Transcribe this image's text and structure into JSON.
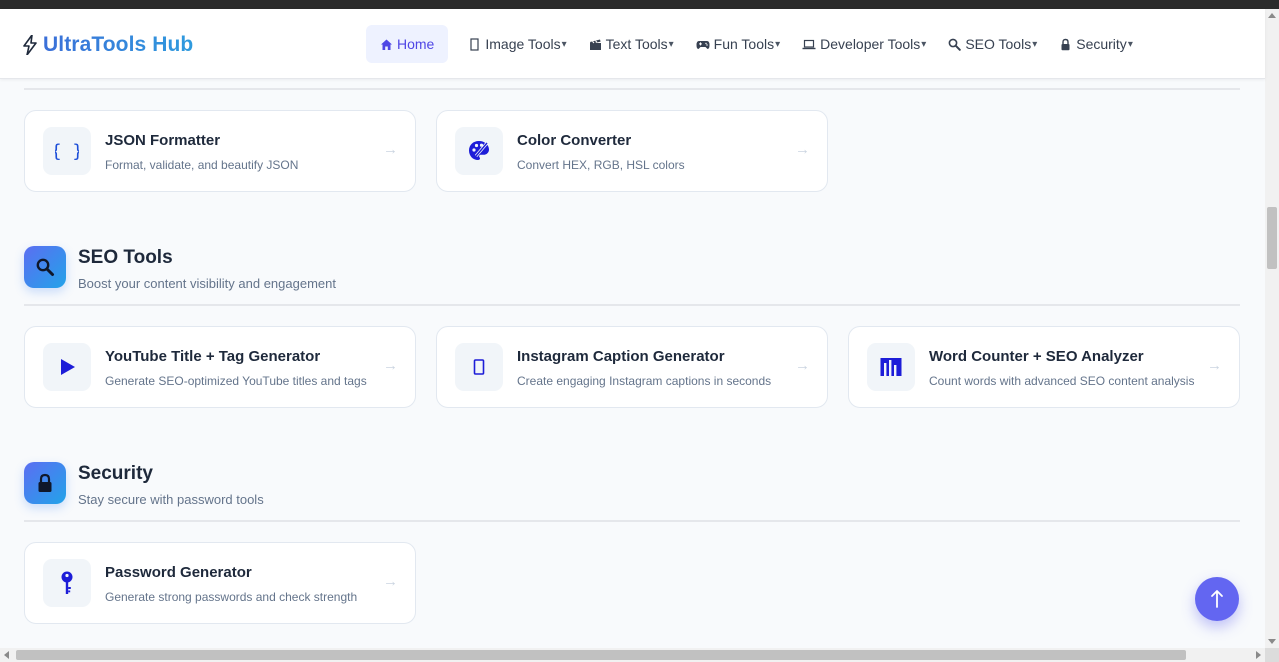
{
  "brand": {
    "name": "UltraTools Hub",
    "icon": "lightning-icon"
  },
  "nav": {
    "home": "Home",
    "image_tools": "Image Tools",
    "text_tools": "Text Tools",
    "fun_tools": "Fun Tools",
    "developer_tools": "Developer Tools",
    "seo_tools": "SEO Tools",
    "security": "Security",
    "caret": "▾"
  },
  "sections": {
    "developer": {
      "cards": [
        {
          "title": "JSON Formatter",
          "desc": "Format, validate, and beautify JSON",
          "icon": "braces-icon"
        },
        {
          "title": "Color Converter",
          "desc": "Convert HEX, RGB, HSL colors",
          "icon": "palette-icon"
        }
      ]
    },
    "seo": {
      "title": "SEO Tools",
      "subtitle": "Boost your content visibility and engagement",
      "icon": "magnifier-icon",
      "cards": [
        {
          "title": "YouTube Title + Tag Generator",
          "desc": "Generate SEO-optimized YouTube titles and tags",
          "icon": "play-icon"
        },
        {
          "title": "Instagram Caption Generator",
          "desc": "Create engaging Instagram captions in seconds",
          "icon": "phone-icon"
        },
        {
          "title": "Word Counter + SEO Analyzer",
          "desc": "Count words with advanced SEO content analysis",
          "icon": "bar-chart-icon"
        }
      ]
    },
    "security": {
      "title": "Security",
      "subtitle": "Stay secure with password tools",
      "icon": "lock-icon",
      "cards": [
        {
          "title": "Password Generator",
          "desc": "Generate strong passwords and check strength",
          "icon": "key-icon"
        }
      ]
    }
  },
  "card_arrow": "→",
  "back_to_top": "↑",
  "colors": {
    "accent": "#6366f1",
    "brand_gradient_start": "#3b6fd8",
    "brand_gradient_end": "#2f9bde",
    "icon_blue": "#1d1dd8"
  }
}
